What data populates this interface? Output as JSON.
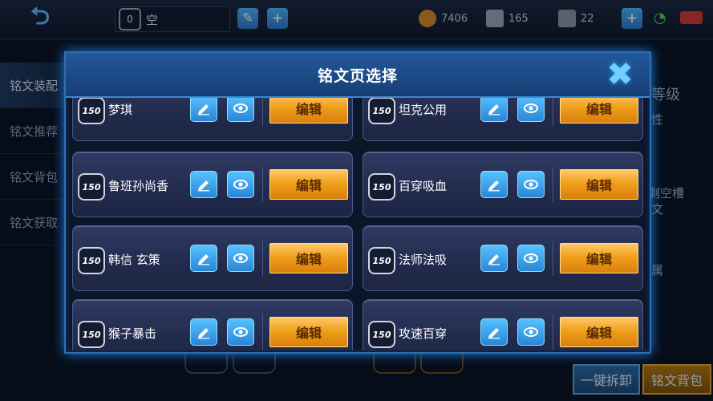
{
  "background": {
    "slot_level": "0",
    "slot_text": "空",
    "resources": [
      {
        "name": "gold",
        "value": "7406",
        "color": "#d58a2a"
      },
      {
        "name": "diamond",
        "value": "165",
        "color": "#9aa6b8"
      },
      {
        "name": "coupon",
        "value": "22",
        "color": "#8b96a8"
      }
    ],
    "left_nav": [
      "铭文装配",
      "铭文推荐",
      "铭文背包",
      "铭文获取"
    ],
    "right_fragments": [
      "等级",
      "性",
      "剩空槽",
      "文",
      "属"
    ],
    "bottom_buttons": [
      "一键拆卸",
      "铭文背包"
    ]
  },
  "modal": {
    "title": "铭文页选择",
    "edit_label": "编辑",
    "pages": [
      {
        "level": "150",
        "name": "梦琪"
      },
      {
        "level": "150",
        "name": "坦克公用"
      },
      {
        "level": "150",
        "name": "鲁班孙尚香"
      },
      {
        "level": "150",
        "name": "百穿吸血"
      },
      {
        "level": "150",
        "name": "韩信 玄策"
      },
      {
        "level": "150",
        "name": "法师法吸"
      },
      {
        "level": "150",
        "name": "猴子暴击"
      },
      {
        "level": "150",
        "name": "攻速百穿"
      }
    ]
  },
  "colors": {
    "accent_blue": "#2a86d6",
    "edit_gold": "#f0a01c",
    "modal_border": "#2f6fb0"
  }
}
